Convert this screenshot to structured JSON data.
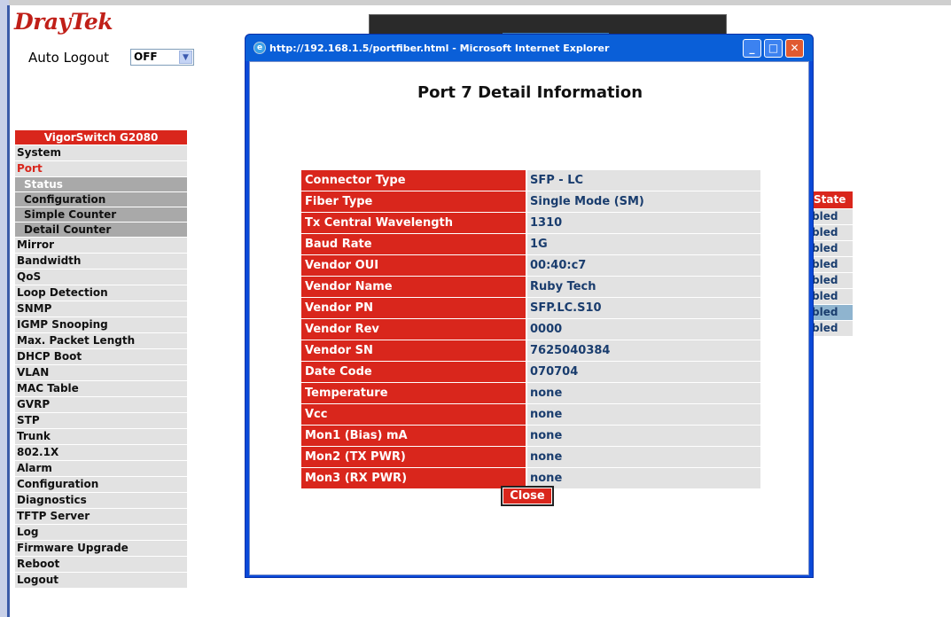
{
  "brand": {
    "name_a": "Dray",
    "name_b": "Tek"
  },
  "auto_logout": {
    "label": "Auto Logout",
    "value": "OFF"
  },
  "sidebar": {
    "header": "VigorSwitch G2080",
    "items": [
      {
        "label": "System"
      },
      {
        "label": "Port"
      },
      {
        "label": "Status"
      },
      {
        "label": "Configuration"
      },
      {
        "label": "Simple Counter"
      },
      {
        "label": "Detail Counter"
      },
      {
        "label": "Mirror"
      },
      {
        "label": "Bandwidth"
      },
      {
        "label": "QoS"
      },
      {
        "label": "Loop Detection"
      },
      {
        "label": "SNMP"
      },
      {
        "label": "IGMP Snooping"
      },
      {
        "label": "Max. Packet Length"
      },
      {
        "label": "DHCP Boot"
      },
      {
        "label": "VLAN"
      },
      {
        "label": "MAC Table"
      },
      {
        "label": "GVRP"
      },
      {
        "label": "STP"
      },
      {
        "label": "Trunk"
      },
      {
        "label": "802.1X"
      },
      {
        "label": "Alarm"
      },
      {
        "label": "Configuration"
      },
      {
        "label": "Diagnostics"
      },
      {
        "label": "TFTP Server"
      },
      {
        "label": "Log"
      },
      {
        "label": "Firmware Upgrade"
      },
      {
        "label": "Reboot"
      },
      {
        "label": "Logout"
      }
    ]
  },
  "background_table": {
    "header": "State",
    "cells": [
      "bled",
      "bled",
      "bled",
      "bled",
      "bled",
      "bled",
      "bled",
      "bled"
    ]
  },
  "popup": {
    "window_title": "http://192.168.1.5/portfiber.html - Microsoft Internet Explorer",
    "heading": "Port 7 Detail Information",
    "rows": [
      {
        "key": "Connector Type",
        "value": "SFP - LC"
      },
      {
        "key": "Fiber Type",
        "value": "Single Mode (SM)"
      },
      {
        "key": "Tx Central Wavelength",
        "value": "1310"
      },
      {
        "key": "Baud Rate",
        "value": "1G"
      },
      {
        "key": "Vendor OUI",
        "value": "00:40:c7"
      },
      {
        "key": "Vendor Name",
        "value": "Ruby Tech"
      },
      {
        "key": "Vendor PN",
        "value": "SFP.LC.S10"
      },
      {
        "key": "Vendor Rev",
        "value": "0000"
      },
      {
        "key": "Vendor SN",
        "value": "7625040384"
      },
      {
        "key": "Date Code",
        "value": "070704"
      },
      {
        "key": "Temperature",
        "value": "none"
      },
      {
        "key": "Vcc",
        "value": "none"
      },
      {
        "key": "Mon1 (Bias) mA",
        "value": "none"
      },
      {
        "key": "Mon2 (TX PWR)",
        "value": "none"
      },
      {
        "key": "Mon3 (RX PWR)",
        "value": "none"
      }
    ],
    "close_label": "Close"
  },
  "colors": {
    "accent": "#d9261c",
    "value_text": "#1a3d6e",
    "titlebar": "#0a5fd8"
  }
}
